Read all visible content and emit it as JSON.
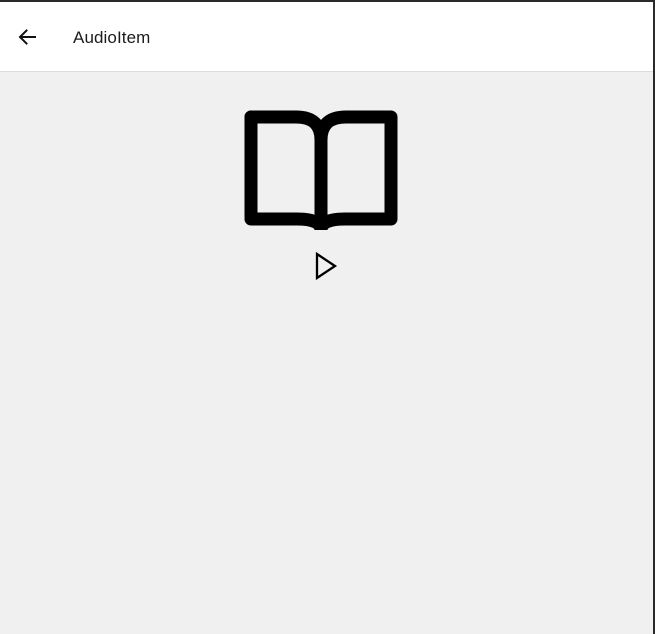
{
  "app_bar": {
    "title": "AudioItem",
    "back_icon": "arrow-left-icon"
  },
  "content": {
    "cover_icon": "open-book-icon",
    "play_icon": "play-icon"
  },
  "colors": {
    "app_bar_background": "#ffffff",
    "page_background": "#f0f0f0",
    "icon_color": "#000000",
    "title_color": "#1b1b1b"
  }
}
